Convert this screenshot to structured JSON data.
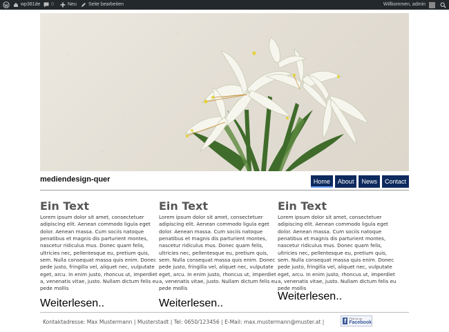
{
  "adminbar": {
    "site_name": "wp381de",
    "comment_count": "0",
    "new_label": "Neu",
    "edit_label": "Seite bearbeiten",
    "welcome": "Willkommen, admin"
  },
  "site": {
    "title": "mediendesign-quer"
  },
  "nav": {
    "home": "Home",
    "about": "About",
    "news": "News",
    "contact": "Contact"
  },
  "columns": [
    {
      "heading": "Ein Text",
      "body": "Lorem ipsum dolor sit amet, consectetuer adipiscing elit. Aenean commodo ligula eget dolor. Aenean massa. Cum sociis natoque penatibus et magnis dis parturient montes, nascetur ridiculus mus. Donec quam felis, ultricies nec, pellentesque eu, pretium quis, sem. Nulla consequat massa quis enim. Donec pede justo, fringilla vel, aliquet nec, vulputate eget, arcu. In enim justo, rhoncus ut, imperdiet a, venenatis vitae, justo. Nullam dictum felis eu pede mollis",
      "more": "Weiterlesen.."
    },
    {
      "heading": "Ein Text",
      "body": "Lorem ipsum dolor sit amet, consectetuer adipiscing elit. Aenean commodo ligula eget dolor. Aenean massa. Cum sociis natoque penatibus et magnis dis parturient montes, nascetur ridiculus mus. Donec quam felis, ultricies nec, pellentesque eu, pretium quis, sem. Nulla consequat massa quis enim. Donec pede justo, fringilla vel, aliquet nec, vulputate eget, arcu. In enim justo, rhoncus ut, imperdiet a, venenatis vitae, justo. Nullam dictum felis eu pede mollis",
      "more": "Weiterlesen.."
    },
    {
      "heading": "Ein Text",
      "body": "Lorem ipsum dolor sit amet, consectetuer adipiscing elit. Aenean commodo ligula eget dolor. Aenean massa. Cum sociis natoque penatibus et magnis dis parturient montes, nascetur ridiculus mus. Donec quam felis, ultricies nec, pellentesque eu, pretium quis, sem. Nulla consequat massa quis enim. Donec pede justo, fringilla vel, aliquet nec, vulputate eget, arcu. In enim justo, rhoncus ut, imperdiet a, venenatis vitae, justo. Nullam dictum felis eu pede mollis",
      "more": "Weiterlesen.."
    }
  ],
  "footer": {
    "contact": "Kontaktadresse: Max Mustermann | Musterstadt | Tel: 0650/123456 | E-Mail: max.mustermann@muster.at |",
    "fb_small": "Find us on",
    "fb_big": "Facebook"
  },
  "colors": {
    "adminbar": "#23282d",
    "nav": "#0d2a5e",
    "heading": "#555555"
  }
}
